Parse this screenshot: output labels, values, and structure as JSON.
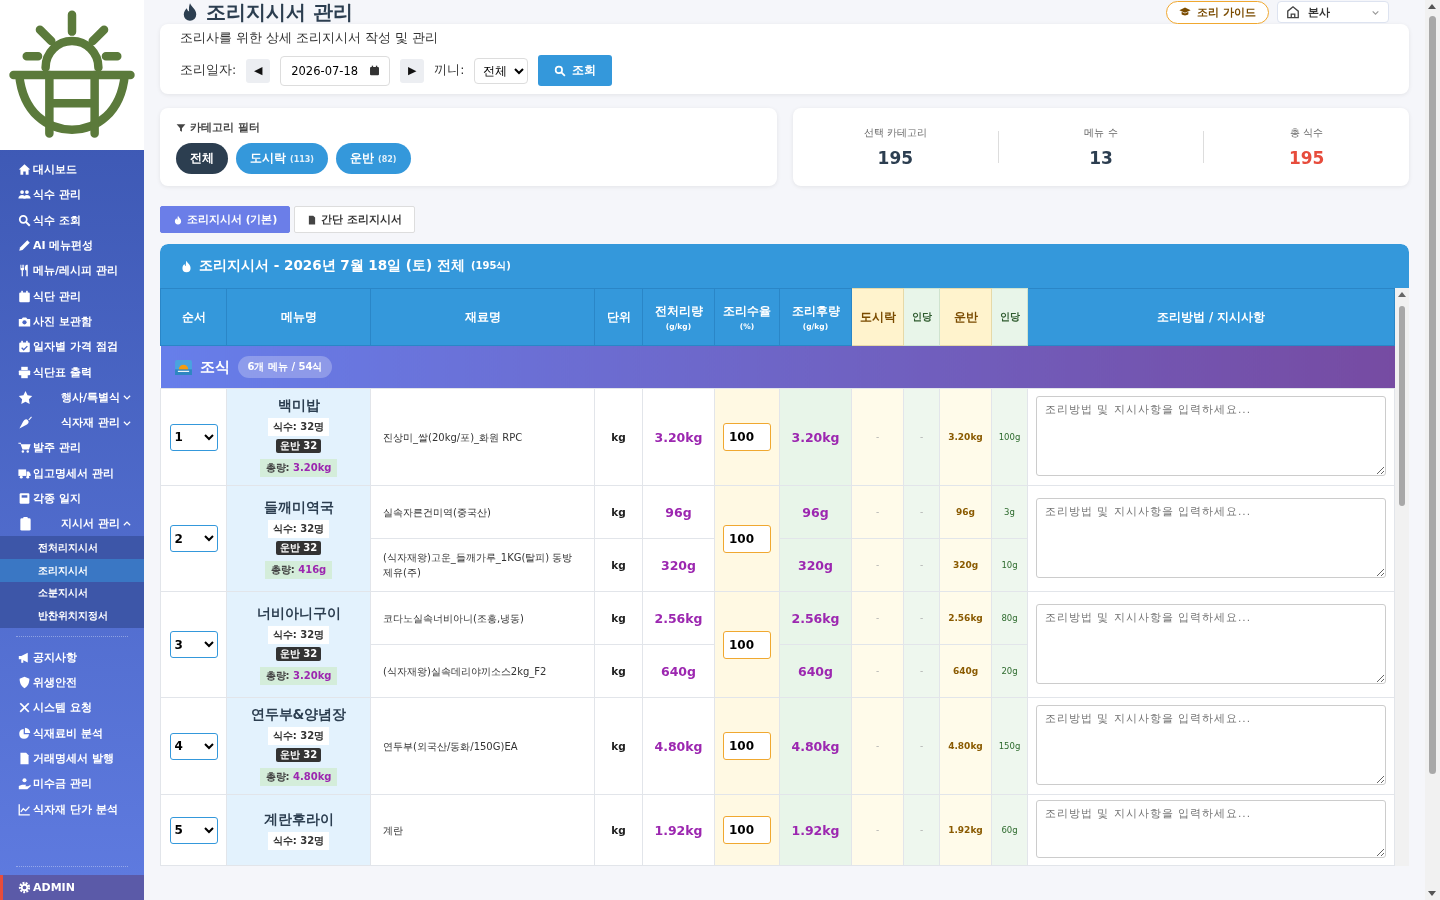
{
  "sidebar": {
    "items": [
      {
        "kind": "link",
        "label": "대시보드"
      },
      {
        "kind": "link",
        "label": "식수 관리"
      },
      {
        "kind": "link",
        "label": "식수 조회"
      },
      {
        "kind": "link",
        "label": "AI 메뉴편성"
      },
      {
        "kind": "link",
        "label": "메뉴/레시피 관리"
      },
      {
        "kind": "link",
        "label": "식단 관리"
      },
      {
        "kind": "link",
        "label": "사진 보관함"
      },
      {
        "kind": "link",
        "label": "일자별 가격 점검"
      },
      {
        "kind": "link",
        "label": "식단표 출력"
      },
      {
        "kind": "group",
        "label": "행사/특별식",
        "expanded": false
      },
      {
        "kind": "group",
        "label": "식자재 관리",
        "expanded": false
      },
      {
        "kind": "link",
        "label": "발주 관리"
      },
      {
        "kind": "link",
        "label": "입고명세서 관리"
      },
      {
        "kind": "link",
        "label": "각종 일지"
      },
      {
        "kind": "group",
        "label": "지시서 관리",
        "expanded": true,
        "children": [
          {
            "label": "전처리지시서",
            "selected": false
          },
          {
            "label": "조리지시서",
            "selected": true
          },
          {
            "label": "소분지시서",
            "selected": false
          },
          {
            "label": "반찬위치지정서",
            "selected": false
          }
        ]
      }
    ],
    "secondary": [
      {
        "label": "공지사항"
      },
      {
        "label": "위생안전"
      },
      {
        "label": "시스템 요청"
      },
      {
        "label": "식재료비 분석"
      },
      {
        "label": "거래명세서 발행"
      },
      {
        "label": "미수금 관리"
      },
      {
        "label": "식자재 단가 분석"
      }
    ],
    "footer": {
      "label": "ADMIN"
    }
  },
  "header": {
    "title": "조리지시서 관리",
    "guide_button": "조리 가이드",
    "site": "본사",
    "subtitle": "조리사를 위한 상세 조리지시서 작성 및 관리",
    "date_label": "조리일자:",
    "prev": "◀",
    "date": "2026-07-18",
    "next": "▶",
    "meal_label": "끼니:",
    "meal": "전체",
    "search_button": "조회"
  },
  "filter": {
    "title": "카테고리 필터",
    "chips": [
      {
        "label": "전체",
        "selected": true
      },
      {
        "label": "도시락",
        "count": "(113)",
        "selected": false
      },
      {
        "label": "운반",
        "count": "(82)",
        "selected": false
      }
    ]
  },
  "stats": [
    {
      "label": "선택 카테고리",
      "value": "195",
      "highlight": false
    },
    {
      "label": "메뉴 수",
      "value": "13",
      "highlight": false
    },
    {
      "label": "총 식수",
      "value": "195",
      "highlight": true
    }
  ],
  "tabs": [
    {
      "label": "조리지시서 (기본)",
      "selected": true
    },
    {
      "label": "간단 조리지시서",
      "selected": false
    }
  ],
  "sheet": {
    "title": "조리지시서 - 2026년 7월 18일 (토) 전체",
    "total": "(195식)",
    "columns": [
      {
        "label": "순서",
        "kind": "main"
      },
      {
        "label": "메뉴명",
        "kind": "main"
      },
      {
        "label": "재료명",
        "kind": "main"
      },
      {
        "label": "단위",
        "kind": "main"
      },
      {
        "label": "전처리량",
        "sub": "(g/kg)",
        "kind": "main"
      },
      {
        "label": "조리수율",
        "sub": "(%)",
        "kind": "main"
      },
      {
        "label": "조리후량",
        "sub": "(g/kg)",
        "kind": "main"
      },
      {
        "label": "도시락",
        "kind": "category"
      },
      {
        "label": "인당",
        "kind": "per"
      },
      {
        "label": "운반",
        "kind": "category"
      },
      {
        "label": "인당",
        "kind": "per"
      },
      {
        "label": "조리방법 / 지시사항",
        "kind": "main"
      }
    ],
    "sections": [
      {
        "name": "조식",
        "summary": "6개 메뉴 / 54식",
        "menus": [
          {
            "order": "1",
            "name": "백미밥",
            "servings": "식수: 32명",
            "badge": "운반 32",
            "total_label": "총량:",
            "total": "3.20kg",
            "yield": "100",
            "note_placeholder": "조리방법 및 지시사항을 입력하세요...",
            "ingredients": [
              {
                "name": "진상미_쌀(20kg/포)_화원 RPC",
                "unit": "kg",
                "raw": "3.20kg",
                "cooked": "3.20kg",
                "lunchbox": "-",
                "lunchbox_per": "-",
                "bulk": "3.20kg",
                "bulk_per": "100g"
              }
            ]
          },
          {
            "order": "2",
            "name": "들깨미역국",
            "servings": "식수: 32명",
            "badge": "운반 32",
            "total_label": "총량:",
            "total": "416g",
            "yield": "100",
            "note_placeholder": "조리방법 및 지시사항을 입력하세요...",
            "ingredients": [
              {
                "name": "실속자른건미역(중국산)",
                "unit": "kg",
                "raw": "96g",
                "cooked": "96g",
                "lunchbox": "-",
                "lunchbox_per": "-",
                "bulk": "96g",
                "bulk_per": "3g"
              },
              {
                "name": "(식자재왕)고운_들깨가루_1KG(탈피) 동방제유(주)",
                "unit": "kg",
                "raw": "320g",
                "cooked": "320g",
                "lunchbox": "-",
                "lunchbox_per": "-",
                "bulk": "320g",
                "bulk_per": "10g"
              }
            ]
          },
          {
            "order": "3",
            "name": "너비아니구이",
            "servings": "식수: 32명",
            "badge": "운반 32",
            "total_label": "총량:",
            "total": "3.20kg",
            "yield": "100",
            "note_placeholder": "조리방법 및 지시사항을 입력하세요...",
            "ingredients": [
              {
                "name": "코다노실속너비아니(조흥,냉동)",
                "unit": "kg",
                "raw": "2.56kg",
                "cooked": "2.56kg",
                "lunchbox": "-",
                "lunchbox_per": "-",
                "bulk": "2.56kg",
                "bulk_per": "80g"
              },
              {
                "name": "(식자재왕)실속데리야끼소스2kg_F2",
                "unit": "kg",
                "raw": "640g",
                "cooked": "640g",
                "lunchbox": "-",
                "lunchbox_per": "-",
                "bulk": "640g",
                "bulk_per": "20g"
              }
            ]
          },
          {
            "order": "4",
            "name": "연두부&양념장",
            "servings": "식수: 32명",
            "badge": "운반 32",
            "total_label": "총량:",
            "total": "4.80kg",
            "yield": "100",
            "note_placeholder": "조리방법 및 지시사항을 입력하세요...",
            "ingredients": [
              {
                "name": "연두부(외국산/동화/150G)EA",
                "unit": "kg",
                "raw": "4.80kg",
                "cooked": "4.80kg",
                "lunchbox": "-",
                "lunchbox_per": "-",
                "bulk": "4.80kg",
                "bulk_per": "150g"
              }
            ]
          },
          {
            "order": "5",
            "name": "계란후라이",
            "servings": "식수: 32명",
            "yield": "100",
            "note_placeholder": "조리방법 및 지시사항을 입력하세요...",
            "ingredients": [
              {
                "name": "계란",
                "unit": "kg",
                "raw": "1.92kg",
                "cooked": "1.92kg",
                "lunchbox": "-",
                "lunchbox_per": "-",
                "bulk": "1.92kg",
                "bulk_per": "60g"
              }
            ]
          }
        ]
      }
    ]
  }
}
